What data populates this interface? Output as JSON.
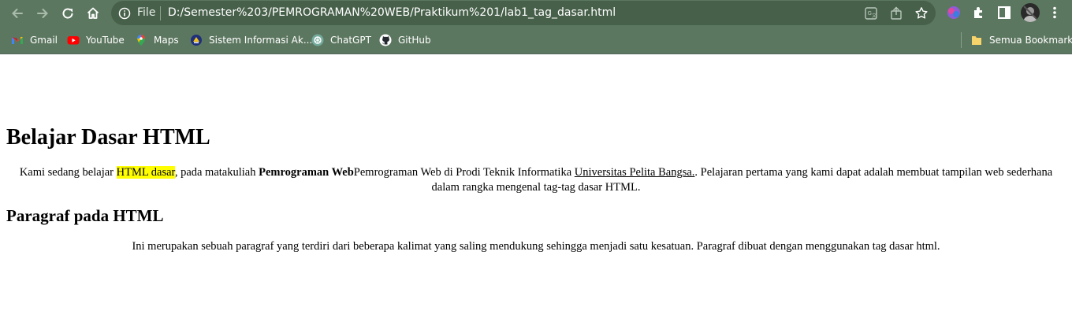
{
  "browser": {
    "scheme_label": "File",
    "url": "D:/Semester%203/PEMROGRAMAN%20WEB/Praktikum%201/lab1_tag_dasar.html",
    "accent": "#5c7760"
  },
  "bookmarks": {
    "items": [
      {
        "label": "Gmail",
        "icon": "gmail-icon"
      },
      {
        "label": "YouTube",
        "icon": "youtube-icon"
      },
      {
        "label": "Maps",
        "icon": "maps-icon"
      },
      {
        "label": "Sistem Informasi Ak...",
        "icon": "campus-icon"
      },
      {
        "label": "ChatGPT",
        "icon": "chatgpt-icon"
      },
      {
        "label": "GitHub",
        "icon": "github-icon"
      }
    ],
    "all_label": "Semua Bookmark"
  },
  "page": {
    "heading": "Belajar Dasar HTML",
    "para1": {
      "t1": "Kami sedang belajar ",
      "highlight": "HTML dasar",
      "t2": ", pada matakuliah ",
      "bold": "Pemrograman Web",
      "t3": "Pemrograman Web di Prodi Teknik Informatika ",
      "link": "Universitas Pelita Bangsa.",
      "t4": ". Pelajaran pertama yang kami dapat adalah membuat tampilan web sederhana dalam rangka mengenal tag-tag dasar HTML."
    },
    "subheading": "Paragraf pada HTML",
    "para2": "Ini merupakan sebuah paragraf yang terdiri dari beberapa kalimat yang saling mendukung sehingga menjadi satu kesatuan. Paragraf dibuat dengan menggunakan tag dasar html."
  }
}
